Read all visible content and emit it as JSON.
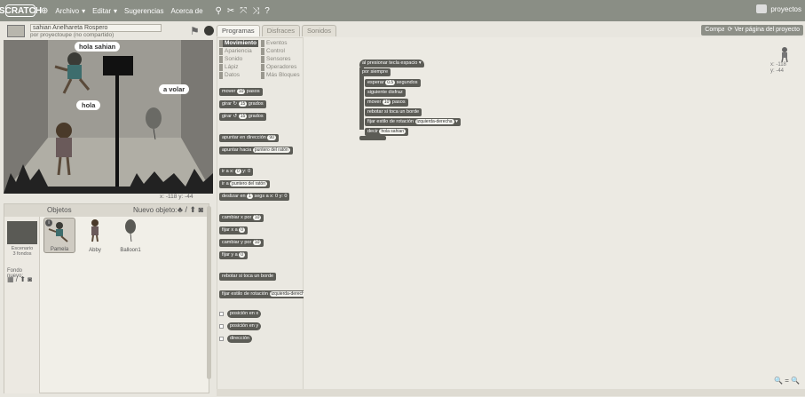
{
  "topbar": {
    "logo": "SCRATCH",
    "menus": [
      "Archivo",
      "Editar",
      "Sugerencias",
      "Acerca de"
    ],
    "tool_icons": [
      "duplicate-icon",
      "delete-icon",
      "grow-icon",
      "shrink-icon",
      "help-icon"
    ],
    "right_label": "proyectos"
  },
  "project": {
    "title": "sahian Anelhareta Rospero",
    "owner": "por proyectoupe (no compartido)"
  },
  "stage": {
    "speech_hola_sahian": "hola sahian",
    "speech_a_volar": "a volar",
    "speech_hola": "hola",
    "coords": "x: -118  y: -44"
  },
  "sprites_panel": {
    "title": "Objetos",
    "new_sprite_label": "Nuevo objeto:",
    "stage_name": "Escenario\n3 fondos",
    "backdrop_label": "Fondo nuevo:",
    "sprites": [
      {
        "name": "Pamela",
        "selected": true
      },
      {
        "name": "Abby",
        "selected": false
      },
      {
        "name": "Balloon1",
        "selected": false
      }
    ]
  },
  "tabs": [
    "Programas",
    "Disfraces",
    "Sonidos"
  ],
  "categories": {
    "left": [
      "Movimiento",
      "Apariencia",
      "Sonido",
      "Lápiz",
      "Datos"
    ],
    "right": [
      "Eventos",
      "Control",
      "Sensores",
      "Operadores",
      "Más Bloques"
    ]
  },
  "palette_blocks": [
    {
      "text": "mover",
      "num": "10",
      "suffix": "pasos"
    },
    {
      "text": "girar",
      "num": "15",
      "suffix": "grados"
    },
    {
      "text": "girar",
      "num": "15",
      "suffix": "grados"
    },
    {
      "text": "apuntar en dirección",
      "num": "90",
      "suffix": ""
    },
    {
      "text": "apuntar hacia",
      "num": "",
      "suffix": "puntero del ratón"
    },
    {
      "text": "ir a x:",
      "num": "0",
      "suffix": "y: 0"
    },
    {
      "text": "ir a",
      "num": "",
      "suffix": "puntero del ratón"
    },
    {
      "text": "deslizar en",
      "num": "1",
      "suffix": "segs a x: 0 y: 0"
    },
    {
      "text": "cambiar x por",
      "num": "10",
      "suffix": ""
    },
    {
      "text": "fijar x a",
      "num": "0",
      "suffix": ""
    },
    {
      "text": "cambiar y por",
      "num": "10",
      "suffix": ""
    },
    {
      "text": "fijar y a",
      "num": "0",
      "suffix": ""
    },
    {
      "text": "rebotar si toca un borde",
      "num": "",
      "suffix": ""
    },
    {
      "text": "fijar estilo de rotación",
      "num": "",
      "suffix": "izquierda-derecha"
    },
    {
      "text": "posición en x",
      "num": "",
      "suffix": ""
    },
    {
      "text": "posición en y",
      "num": "",
      "suffix": ""
    },
    {
      "text": "dirección",
      "num": "",
      "suffix": ""
    }
  ],
  "script": {
    "share_button": "Compartir",
    "view_page_button": "Ver página del proyecto",
    "hat": "al presionar tecla  espacio",
    "forever": "por siempre",
    "body": [
      {
        "text": "esperar",
        "num": "0.5",
        "suffix": "segundos"
      },
      {
        "text": "siguiente disfraz",
        "num": "",
        "suffix": ""
      },
      {
        "text": "mover",
        "num": "10",
        "suffix": "pasos"
      },
      {
        "text": "rebotar si toca un borde",
        "num": "",
        "suffix": ""
      },
      {
        "text": "fijar estilo de rotación",
        "num": "",
        "suffix": "izquierda-derecha"
      },
      {
        "text": "decir",
        "num": "",
        "suffix": "hola sahian"
      }
    ],
    "sprite_x": "x: -118",
    "sprite_y": "y: -44",
    "zoom_icons": [
      "zoom-out-icon",
      "zoom-reset-icon",
      "zoom-in-icon"
    ]
  },
  "colors": {
    "topbar": "#8a8e85",
    "block": "#5c5c56",
    "background": "#e8e6df"
  }
}
